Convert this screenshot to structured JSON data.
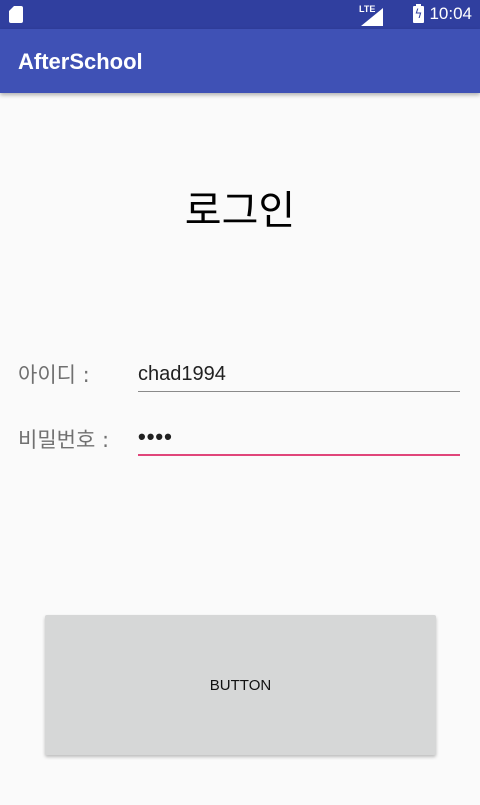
{
  "status_bar": {
    "network": "LTE",
    "time": "10:04",
    "icons": [
      "sd-card-icon",
      "signal-icon",
      "battery-charging-icon"
    ]
  },
  "app_bar": {
    "title": "AfterSchool"
  },
  "login": {
    "title": "로그인",
    "id_label": "아이디 :",
    "id_value": "chad1994",
    "password_label": "비밀번호 :",
    "password_value": "••••",
    "button_label": "BUTTON"
  },
  "colors": {
    "status_bar": "#303f9f",
    "app_bar": "#3f51b5",
    "focus_accent": "#e0457a",
    "button": "#d6d7d7"
  }
}
